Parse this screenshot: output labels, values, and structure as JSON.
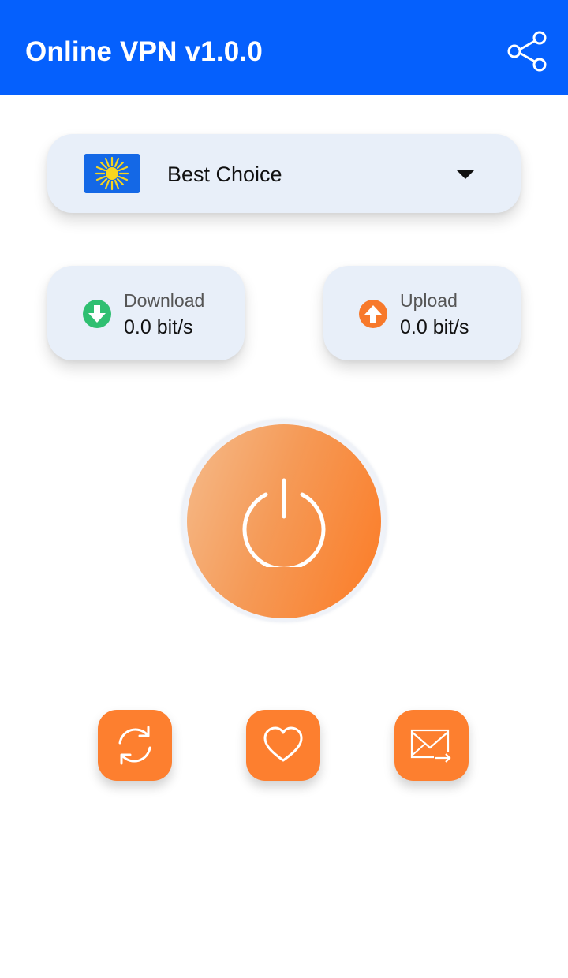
{
  "appbar": {
    "title": "Online VPN v1.0.0",
    "color": "#0560fd",
    "share_icon": "share-icon"
  },
  "server": {
    "name": "Best Choice",
    "flag_icon": "sun-flag-icon",
    "dropdown_icon": "caret-down-icon"
  },
  "stats": {
    "download": {
      "label": "Download",
      "value": "0.0 bit/s",
      "icon": "arrow-down-circle-icon",
      "color": "#2fbf71"
    },
    "upload": {
      "label": "Upload",
      "value": "0.0 bit/s",
      "icon": "arrow-up-circle-icon",
      "color": "#f7792b"
    }
  },
  "power": {
    "icon": "power-icon",
    "accent": "#fc7b25"
  },
  "actions": [
    {
      "icon": "refresh-icon"
    },
    {
      "icon": "heart-icon"
    },
    {
      "icon": "mail-forward-icon"
    }
  ]
}
